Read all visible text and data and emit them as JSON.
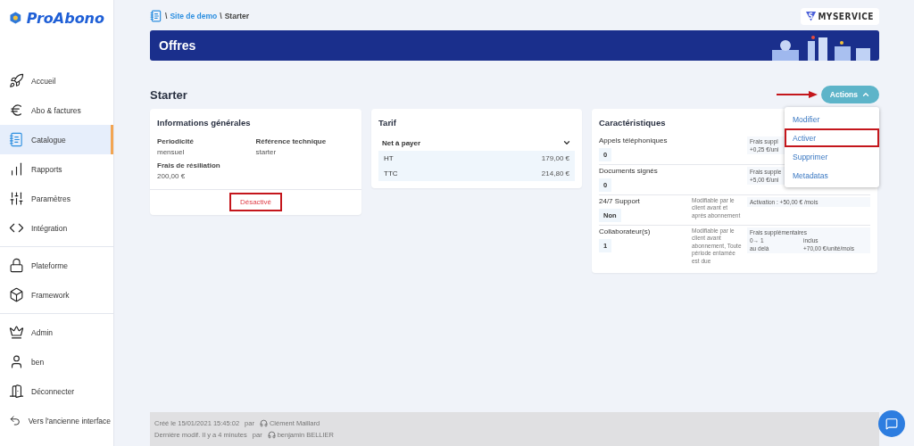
{
  "logo": {
    "text": "ProAbono"
  },
  "sidebar": {
    "groups": [
      [
        {
          "label": "Accueil",
          "selected": false
        },
        {
          "label": "Abo & factures",
          "selected": false
        },
        {
          "label": "Catalogue",
          "selected": true
        },
        {
          "label": "Rapports",
          "selected": false
        },
        {
          "label": "Paramètres",
          "selected": false
        },
        {
          "label": "Intégration",
          "selected": false
        }
      ],
      [
        {
          "label": "Plateforme",
          "selected": false
        },
        {
          "label": "Framework",
          "selected": false
        }
      ],
      [
        {
          "label": "Admin",
          "selected": false
        },
        {
          "label": "ben",
          "selected": false
        },
        {
          "label": "Déconnecter",
          "selected": false
        },
        {
          "label": "Vers l'ancienne interface",
          "selected": false
        }
      ]
    ]
  },
  "breadcrumb": {
    "sep": "\\",
    "link": "Site de demo",
    "current": "Starter"
  },
  "brand": {
    "mark": "S",
    "text": "MYSERVICE"
  },
  "banner": {
    "title": "Offres"
  },
  "page_title": "Starter",
  "actions": {
    "label": "Actions",
    "expanded": true,
    "menu": [
      {
        "label": "Modifier",
        "highlighted": false
      },
      {
        "label": "Activer",
        "highlighted": true
      },
      {
        "label": "Supprimer",
        "highlighted": false
      },
      {
        "label": "Metadatas",
        "highlighted": false
      }
    ]
  },
  "general": {
    "title": "Informations générales",
    "fields": [
      {
        "label": "Periodicité",
        "value": "mensuel"
      },
      {
        "label": "Référence technique",
        "value": "starter"
      },
      {
        "label": "Frais de résiliation",
        "value": "200,00 €"
      }
    ],
    "status": {
      "label": "Désactivé",
      "highlighted": true
    }
  },
  "tarif": {
    "title": "Tarif",
    "select": "Net à payer",
    "rows": [
      {
        "label": "HT",
        "value": "179,00 €"
      },
      {
        "label": "TTC",
        "value": "214,80 €"
      }
    ]
  },
  "characteristics": {
    "title": "Caractéristiques",
    "rows": [
      {
        "name": "Appels téléphoniques",
        "value": "0",
        "pricing": [
          [
            "Frais suppl"
          ],
          [
            "+0,25 €/uni"
          ]
        ]
      },
      {
        "name": "Documents signés",
        "value": "0",
        "pricing": [
          [
            "Frais supple"
          ],
          [
            "+5,00 €/uni"
          ]
        ]
      },
      {
        "name": "24/7 Support",
        "value": "Non",
        "note": "Modifiable par le client avant et après abonnement",
        "pricing": [
          [
            "Activation :  +50,00 €  /mois"
          ]
        ]
      },
      {
        "name": "Collaborateur(s)",
        "value": "1",
        "note": "Modifiable par le client avant abonnement, Toute période entamée est due",
        "pricing": [
          [
            "Frais supplémentaires"
          ],
          [
            "0→ 1",
            "inclus"
          ],
          [
            "au delà",
            "+70,00 €/unité/mois"
          ]
        ]
      }
    ]
  },
  "footer": {
    "lines": [
      {
        "prefix": "Créé  le 15/01/2021 15:45:02",
        "by": "par",
        "user": "Clément Maillard"
      },
      {
        "prefix": "Dernière modif. Il y a 4 minutes",
        "by": "par",
        "user": "benjamin BELLIER"
      }
    ]
  }
}
